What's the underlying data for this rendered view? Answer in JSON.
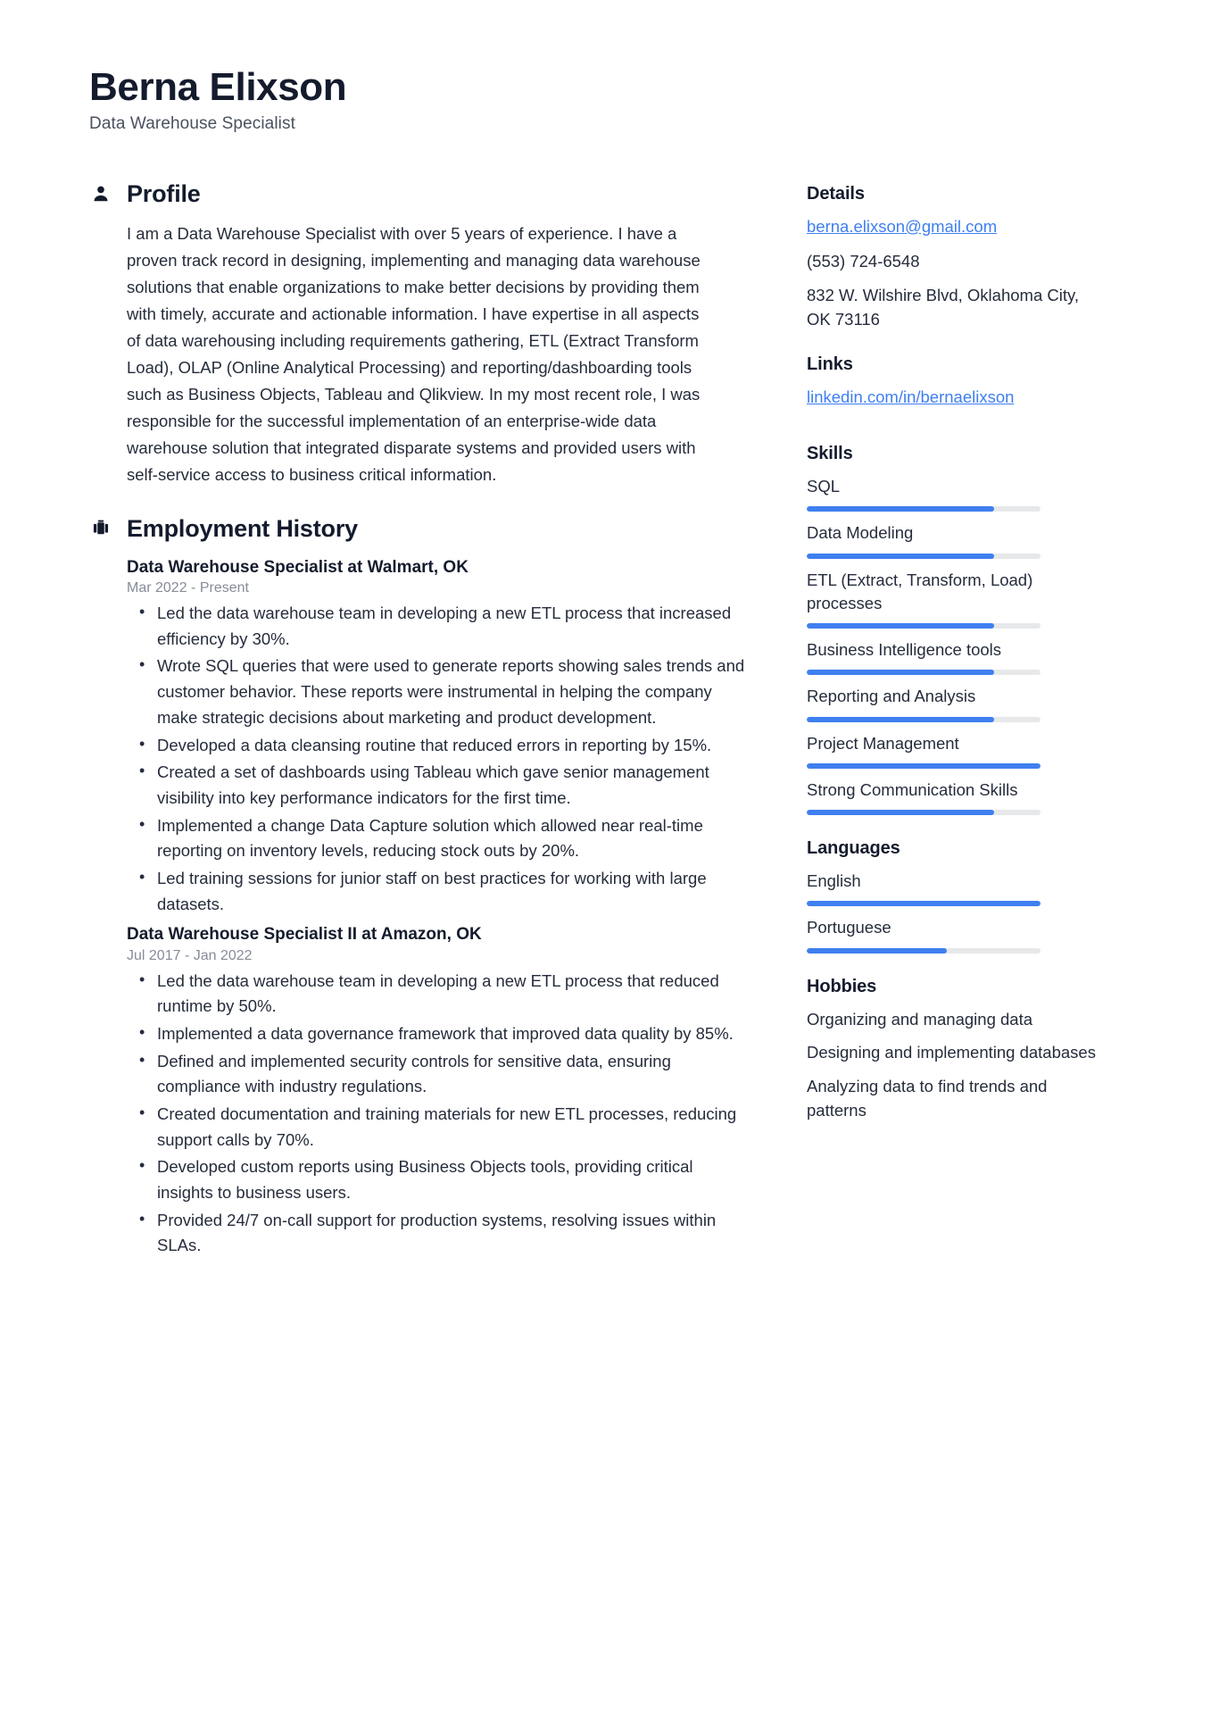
{
  "accent_color": "#3f7ff0",
  "text_color": "#252c3c",
  "heading_color": "#141b2d",
  "track_color": "#e6e8ea",
  "header": {
    "name": "Berna Elixson",
    "title": "Data Warehouse Specialist"
  },
  "profile": {
    "icon": "person-icon",
    "heading": "Profile",
    "text": "I am a Data Warehouse Specialist with over 5 years of experience. I have a proven track record in designing, implementing and managing data warehouse solutions that enable organizations to make better decisions by providing them with timely, accurate and actionable information. I have expertise in all aspects of data warehousing including requirements gathering, ETL (Extract Transform Load), OLAP (Online Analytical Processing) and reporting/dashboarding tools such as Business Objects, Tableau and Qlikview. In my most recent role, I was responsible for the successful implementation of an enterprise-wide data warehouse solution that integrated disparate systems and provided users with self-service access to business critical information."
  },
  "employment": {
    "icon": "briefcase-icon",
    "heading": "Employment History",
    "jobs": [
      {
        "title": "Data Warehouse Specialist at Walmart, OK",
        "date": "Mar 2022 - Present",
        "bullets": [
          "Led the data warehouse team in developing a new ETL process that increased efficiency by 30%.",
          "Wrote SQL queries that were used to generate reports showing sales trends and customer behavior. These reports were instrumental in helping the company make strategic decisions about marketing and product development.",
          "Developed a data cleansing routine that reduced errors in reporting by 15%.",
          "Created a set of dashboards using Tableau which gave senior management visibility into key performance indicators for the first time.",
          "Implemented a change Data Capture solution which allowed near real-time reporting on inventory levels, reducing stock outs by 20%.",
          "Led training sessions for junior staff on best practices for working with large datasets."
        ]
      },
      {
        "title": "Data Warehouse Specialist II at Amazon, OK",
        "date": "Jul 2017 - Jan 2022",
        "bullets": [
          "Led the data warehouse team in developing a new ETL process that reduced runtime by 50%.",
          "Implemented a data governance framework that improved data quality by 85%.",
          "Defined and implemented security controls for sensitive data, ensuring compliance with industry regulations.",
          "Created documentation and training materials for new ETL processes, reducing support calls by 70%.",
          "Developed custom reports using Business Objects tools, providing critical insights to business users.",
          "Provided 24/7 on-call support for production systems, resolving issues within SLAs."
        ]
      }
    ]
  },
  "details": {
    "heading": "Details",
    "email": "berna.elixson@gmail.com",
    "phone": "(553) 724-6548",
    "address": "832 W. Wilshire Blvd, Oklahoma City, OK 73116"
  },
  "links": {
    "heading": "Links",
    "items": [
      {
        "label": "linkedin.com/in/bernaelixson"
      }
    ]
  },
  "skills": {
    "heading": "Skills",
    "items": [
      {
        "label": "SQL",
        "level": 80
      },
      {
        "label": "Data Modeling",
        "level": 80
      },
      {
        "label": "ETL (Extract, Transform, Load) processes",
        "level": 80
      },
      {
        "label": "Business Intelligence tools",
        "level": 80
      },
      {
        "label": "Reporting and Analysis",
        "level": 80
      },
      {
        "label": "Project Management",
        "level": 100
      },
      {
        "label": "Strong Communication Skills",
        "level": 80
      }
    ]
  },
  "languages": {
    "heading": "Languages",
    "items": [
      {
        "label": "English",
        "level": 100
      },
      {
        "label": "Portuguese",
        "level": 60
      }
    ]
  },
  "hobbies": {
    "heading": "Hobbies",
    "items": [
      {
        "label": "Organizing and managing data"
      },
      {
        "label": "Designing and implementing databases"
      },
      {
        "label": "Analyzing data to find trends and patterns"
      }
    ]
  }
}
